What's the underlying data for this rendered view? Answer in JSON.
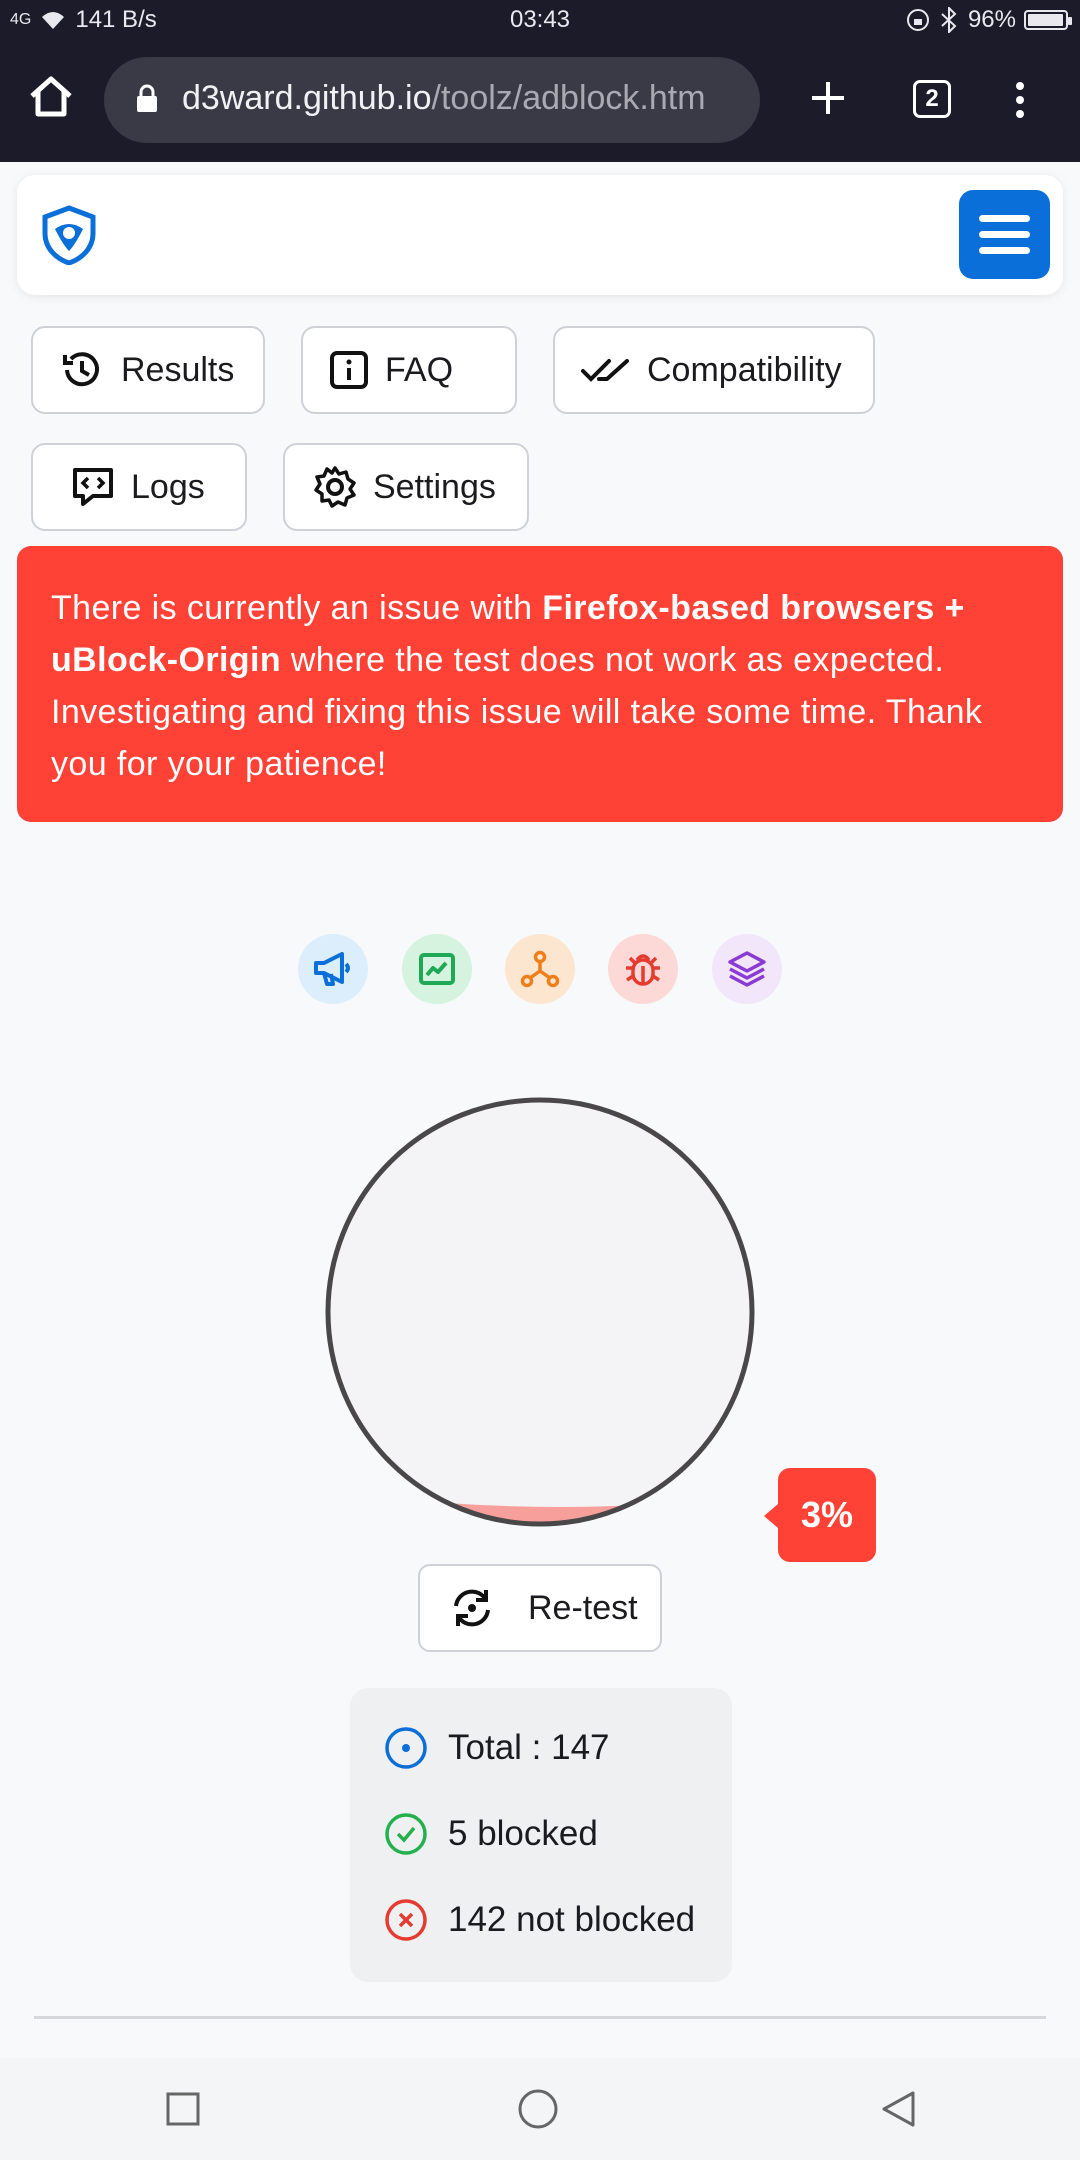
{
  "status_bar": {
    "network": "4G",
    "speed": "141 B/s",
    "time": "03:43",
    "battery": "96%",
    "battery_level": 0.96
  },
  "browser": {
    "url_host": "d3ward.github.io",
    "url_path": "/toolz/adblock.htm",
    "tab_count": "2"
  },
  "nav": {
    "results": "Results",
    "faq": "FAQ",
    "compatibility": "Compatibility",
    "logs": "Logs",
    "settings": "Settings"
  },
  "alert": {
    "part1": "There is currently an issue with ",
    "bold": "Firefox-based browsers + uBlock-Origin",
    "part2": " where the test does not work as expected. Investigating and fixing this issue will take some time. Thank you for your patience!"
  },
  "categories": [
    {
      "icon": "megaphone-icon",
      "color": "#0a6fd8",
      "bg": "#dceefc"
    },
    {
      "icon": "analytics-icon",
      "color": "#1fa855",
      "bg": "#d5f3df"
    },
    {
      "icon": "network-icon",
      "color": "#f07f1b",
      "bg": "#fde6cf"
    },
    {
      "icon": "bug-icon",
      "color": "#e53b30",
      "bg": "#fcd9d6"
    },
    {
      "icon": "layers-icon",
      "color": "#8a3bd6",
      "bg": "#f1e6fa"
    }
  ],
  "result": {
    "percent": "3%",
    "percent_value": 0.03,
    "retest_label": "Re-test"
  },
  "stats": {
    "total": "Total : 147",
    "blocked": "5 blocked",
    "not_blocked": "142 not blocked"
  },
  "colors": {
    "accent": "#0a6fd8",
    "alert": "#ff4136",
    "success": "#22b14c",
    "danger": "#e53b30"
  }
}
